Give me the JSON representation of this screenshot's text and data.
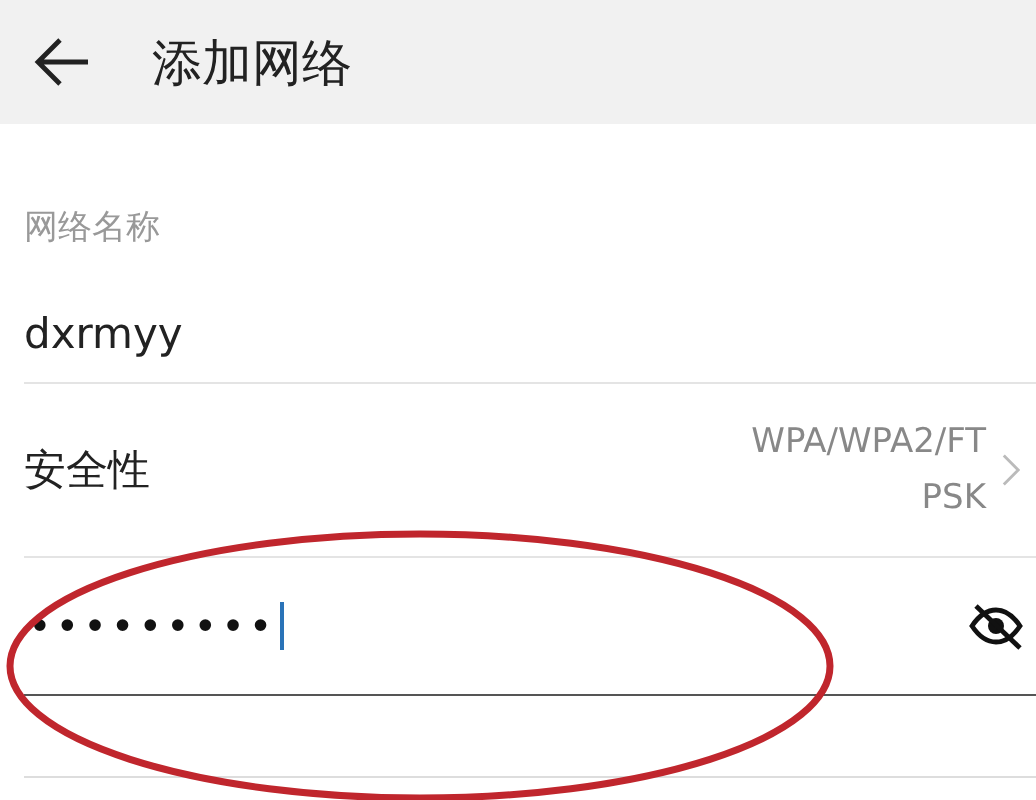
{
  "header": {
    "title": "添加网络"
  },
  "network_name": {
    "label": "网络名称",
    "value": "dxrmyy"
  },
  "security": {
    "label": "安全性",
    "value": "WPA/WPA2/FT PSK"
  },
  "password": {
    "value": "•••••••••",
    "focused": true,
    "visible": false
  },
  "annotation": {
    "kind": "ellipse",
    "color": "#c0262d"
  }
}
